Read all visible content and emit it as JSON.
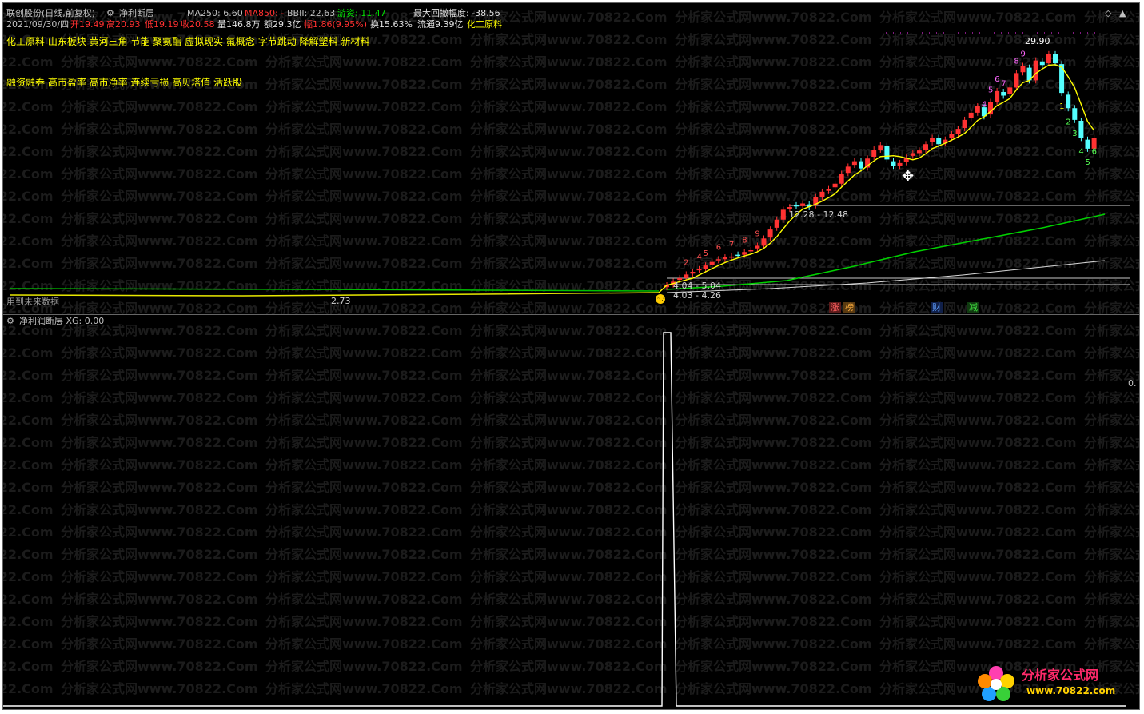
{
  "header": {
    "stock_title": "联创股份(日线,前复权)",
    "indicator_name": "净利断层",
    "ma250": "MA250: 6.60",
    "ma850": "MA850: -",
    "bbi": "BBII: 22.63",
    "youzi": "游资: 11.47",
    "max_drawdown": "最大回撤幅度: -38.56"
  },
  "info_row": {
    "date": "2021/09/30/四",
    "open": "开19.49",
    "high": "高20.93",
    "low": "低19.19",
    "close": "收20.58",
    "volume": "量146.8万",
    "amount": "额29.3亿",
    "change": "幅1.86(9.95%)",
    "turnover": "换15.63%",
    "float_cap": "流通9.39亿",
    "sector": "化工原料"
  },
  "concepts_line1": "化工原料 山东板块 黄河三角 节能 聚氨酯 虚拟现实 氟概念 字节跳动 降解塑料 新材料",
  "concepts_line2": "融资融券 高市盈率 高市净率 连续亏损 高贝塔值 活跃股",
  "top_panel_labels": {
    "peak": "29.90",
    "box_label": "12.28 - 12.48",
    "range_label_1": "4.04 - 5.04",
    "range_label_2": "4.03 - 4.26",
    "left_low": "2.73",
    "left_caption": "用到未来数据",
    "tag_zhang": "涨",
    "tag_bang": "榜",
    "tag_cai": "财",
    "tag_jian": "减"
  },
  "bottom_panel": {
    "title": "净利润断层 XG: 0.00",
    "right_axis": "0."
  },
  "watermark": {
    "text": "分析家公式网www.70822.Com",
    "logo_text": "分析家公式网",
    "logo_url": "www.70822.com"
  },
  "colors": {
    "up": "#ff3232",
    "down": "#54ffff",
    "ma_short": "#ffff00",
    "ma_mid": "#00d000",
    "ma_long": "#d8d8d8",
    "text_header": "#c0c0c0",
    "text_yellow": "#ffff00"
  },
  "chart_data": [
    {
      "type": "candlestick",
      "title": "联创股份(日线,前复权)",
      "x": [
        "2021/09/30"
      ],
      "candles": [
        {
          "date": "2021/09/30",
          "open": 19.49,
          "high": 20.93,
          "low": 19.19,
          "close": 20.58
        }
      ],
      "series": [
        {
          "name": "MA250",
          "values": [
            6.6
          ]
        },
        {
          "name": "BBII",
          "values": [
            22.63
          ]
        }
      ],
      "annotations": [
        "29.90",
        "12.28 - 12.48",
        "4.04 - 5.04",
        "4.03 - 4.26",
        "2.73"
      ]
    },
    {
      "type": "line",
      "title": "净利润断层 XG: 0.00",
      "series": [
        {
          "name": "XG",
          "values": [
            0,
            1,
            0
          ]
        }
      ],
      "ylim": [
        0,
        1
      ]
    }
  ]
}
